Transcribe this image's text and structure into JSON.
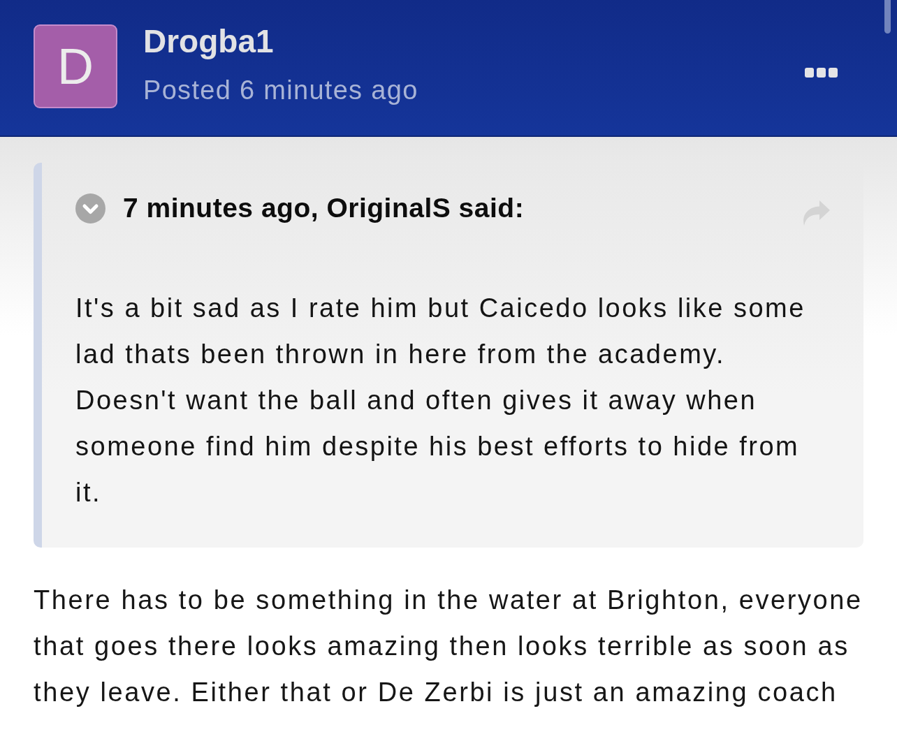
{
  "post": {
    "author": {
      "initial": "D",
      "name": "Drogba1",
      "posted": "Posted 6 minutes ago"
    },
    "quote": {
      "citation": "7 minutes ago, OriginalS said:",
      "text": "It's a bit sad as I rate him but Caicedo looks like some lad thats been thrown in here from the academy. Doesn't want the ball and often gives it away when someone find him despite his best efforts to hide from it."
    },
    "body": "There has to be something in the water at Brighton, everyone that goes there looks amazing then looks terrible as soon as they leave. Either that or De Zerbi is just an amazing coach"
  }
}
